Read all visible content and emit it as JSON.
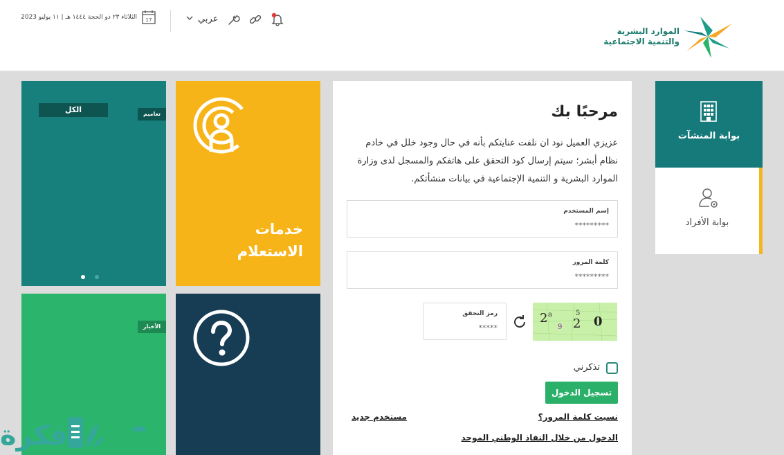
{
  "header": {
    "logo_line1": "الموارد البشرية",
    "logo_line2": "والتنمية الاجتماعية",
    "date": "الثلاثاء ٢٣ ذو الحجة ١٤٤٤ هـ | ١١ يوليو 2023",
    "calendar_day": "17",
    "language": "عربي"
  },
  "portals": {
    "establishments": "بوابة المنشآت",
    "individuals": "بوابة الأفراد"
  },
  "login": {
    "title": "مرحبًا بك",
    "description": "عزيزي العميل نود ان نلفت عنايتكم بأنه في حال وجود خلل في خادم نظام أبشر؛ سيتم إرسال كود التحقق على هاتفكم والمسجل لدى وزارة الموارد البشرية و التنمية الإجتماعية في بيانات منشأتكم.",
    "username_label": "إسم المستخدم",
    "username_placeholder": "*********",
    "password_label": "كلمة المرور",
    "password_placeholder": "*********",
    "captcha_label": "رمز التحقق",
    "captcha_placeholder": "*****",
    "captcha_chars": [
      "2",
      "a",
      "9",
      "2",
      "5",
      "0"
    ],
    "remember_label": "تذكرني",
    "login_button": "تسجيل الدخول",
    "forgot_password": "نسيت كلمة المرور؟",
    "new_user": "مستخدم جديد",
    "nafath_login": "الدخول من خلال النفاذ الوطني الموحد"
  },
  "tiles": {
    "all_tab": "الكل",
    "general_tag": "تعاميم",
    "news_tag": "الأخبار",
    "inquiry_title_line1": "خدمات",
    "inquiry_title_line2": "الاستعلام"
  },
  "colors": {
    "teal": "#17807c",
    "yellow": "#f7b418",
    "green": "#2bb56c",
    "navy": "#173d55",
    "portal_active": "#177a7a",
    "button": "#2bb06a"
  },
  "icons": {
    "calendar": "calendar-icon",
    "link": "link-icon",
    "wrench": "wrench-icon",
    "bell": "bell-icon",
    "building": "building-icon",
    "user_settings": "user-settings-icon",
    "refresh": "refresh-icon",
    "broadcast_user": "broadcast-user-icon",
    "question": "question-icon"
  },
  "watermark": {
    "text": "فكرة"
  }
}
